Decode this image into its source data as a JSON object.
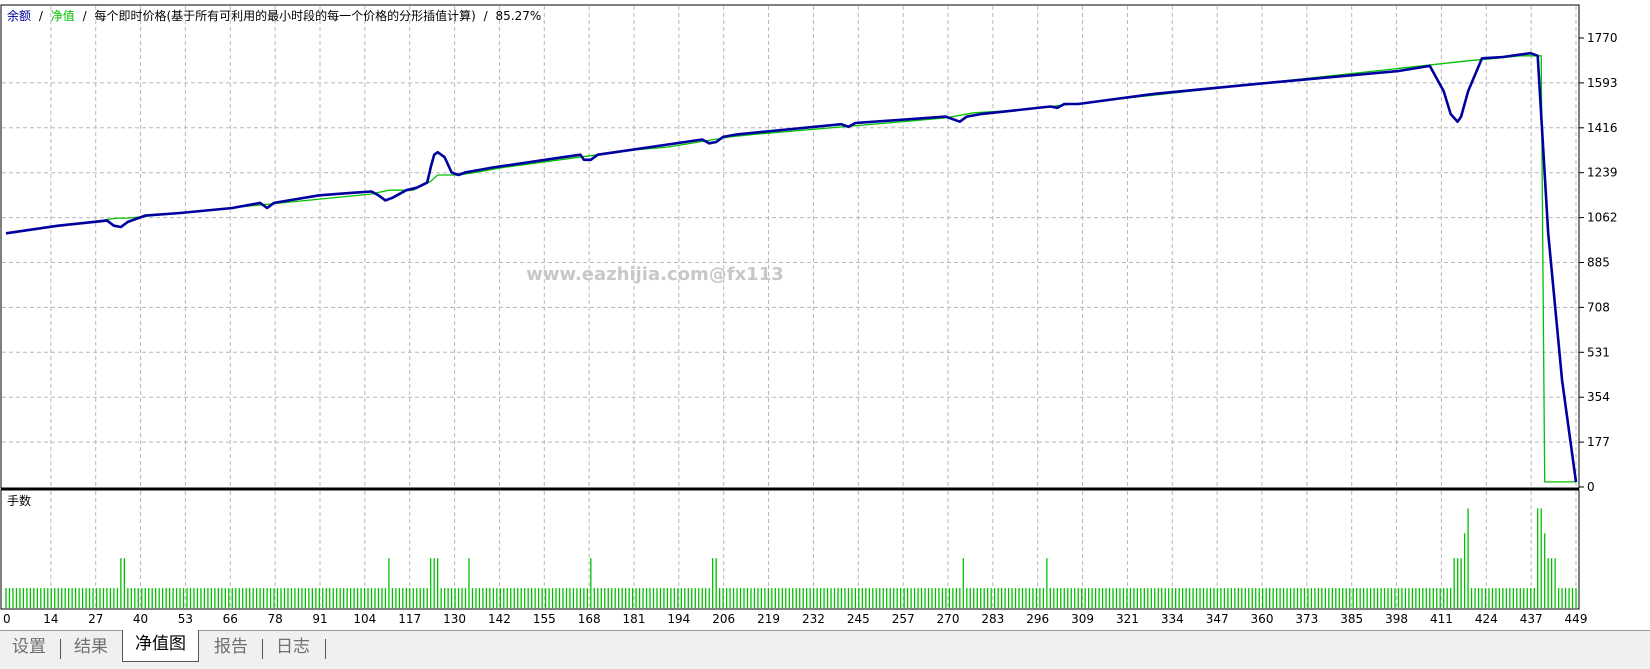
{
  "header": {
    "balance": "余额",
    "sep1": "/",
    "equity": "净值",
    "sep2": "/",
    "method": "每个即时价格(基于所有可利用的最小时段的每一个价格的分形插值计算)",
    "sep3": "/",
    "quality": "85.27%"
  },
  "watermark": "www.eazhijia.com@fx113",
  "lower_panel_label": "手数",
  "tabs": [
    {
      "label": "设置",
      "active": false
    },
    {
      "label": "结果",
      "active": false
    },
    {
      "label": "净值图",
      "active": true
    },
    {
      "label": "报告",
      "active": false
    },
    {
      "label": "日志",
      "active": false
    }
  ],
  "colors": {
    "balance": "#00c000",
    "equity": "#0000a0",
    "lots": "#00c000",
    "grid": "#b8b8b8"
  },
  "chart_data": {
    "type": "line",
    "series": [
      {
        "name": "余额",
        "color": "#00c000",
        "x": [
          0,
          32,
          35,
          105,
          110,
          117,
          122,
          124,
          128,
          130,
          135,
          143,
          170,
          177,
          190,
          208,
          215,
          270,
          278,
          290,
          420,
          428,
          435,
          436,
          441,
          442,
          451
        ],
        "y": [
          1000,
          1060,
          1060,
          1155,
          1170,
          1170,
          1205,
          1230,
          1230,
          1230,
          1240,
          1260,
          1310,
          1325,
          1340,
          1380,
          1390,
          1455,
          1475,
          1485,
          1680,
          1690,
          1700,
          1700,
          1700,
          20,
          20
        ]
      },
      {
        "name": "净值",
        "color": "#0000a0",
        "x": [
          0,
          15,
          29,
          31,
          33,
          35,
          40,
          50,
          65,
          73,
          75,
          77,
          90,
          100,
          105,
          107,
          109,
          111,
          115,
          118,
          121,
          122,
          123,
          124,
          126,
          128,
          130,
          132,
          140,
          160,
          165,
          166,
          168,
          170,
          175,
          200,
          202,
          204,
          206,
          210,
          240,
          242,
          244,
          270,
          272,
          274,
          276,
          280,
          300,
          302,
          304,
          308,
          330,
          360,
          400,
          409,
          413,
          415,
          417,
          418,
          420,
          424,
          430,
          435,
          438,
          440,
          443,
          447,
          451
        ],
        "y": [
          1000,
          1030,
          1050,
          1030,
          1025,
          1045,
          1070,
          1080,
          1100,
          1120,
          1100,
          1120,
          1150,
          1160,
          1165,
          1150,
          1130,
          1140,
          1170,
          1180,
          1200,
          1260,
          1310,
          1320,
          1300,
          1240,
          1230,
          1240,
          1260,
          1300,
          1310,
          1290,
          1290,
          1310,
          1320,
          1370,
          1355,
          1360,
          1380,
          1390,
          1430,
          1420,
          1435,
          1460,
          1450,
          1440,
          1460,
          1470,
          1500,
          1495,
          1510,
          1510,
          1550,
          1590,
          1640,
          1660,
          1560,
          1470,
          1440,
          1460,
          1560,
          1690,
          1695,
          1705,
          1710,
          1700,
          1000,
          420,
          20
        ]
      }
    ],
    "lots": {
      "base": 0.08,
      "spikes": [
        {
          "x": 33,
          "value": 0.2
        },
        {
          "x": 34,
          "value": 0.2
        },
        {
          "x": 110,
          "value": 0.2
        },
        {
          "x": 122,
          "value": 0.2
        },
        {
          "x": 123,
          "value": 0.2
        },
        {
          "x": 124,
          "value": 0.2
        },
        {
          "x": 133,
          "value": 0.2
        },
        {
          "x": 168,
          "value": 0.2
        },
        {
          "x": 203,
          "value": 0.2
        },
        {
          "x": 204,
          "value": 0.2
        },
        {
          "x": 275,
          "value": 0.2
        },
        {
          "x": 299,
          "value": 0.2
        },
        {
          "x": 416,
          "value": 0.2
        },
        {
          "x": 417,
          "value": 0.2
        },
        {
          "x": 418,
          "value": 0.2
        },
        {
          "x": 419,
          "value": 0.3
        },
        {
          "x": 420,
          "value": 0.4
        },
        {
          "x": 440,
          "value": 0.4
        },
        {
          "x": 441,
          "value": 0.4
        },
        {
          "x": 442,
          "value": 0.3
        },
        {
          "x": 443,
          "value": 0.2
        },
        {
          "x": 444,
          "value": 0.2
        },
        {
          "x": 445,
          "value": 0.2
        }
      ]
    },
    "xticks": [
      "0",
      "14",
      "27",
      "40",
      "53",
      "66",
      "78",
      "91",
      "104",
      "117",
      "130",
      "142",
      "155",
      "168",
      "181",
      "194",
      "206",
      "219",
      "232",
      "245",
      "257",
      "270",
      "283",
      "296",
      "309",
      "321",
      "334",
      "347",
      "360",
      "373",
      "385",
      "398",
      "411",
      "424",
      "437",
      "449"
    ],
    "yticks": [
      "0",
      "177",
      "354",
      "531",
      "708",
      "885",
      "1062",
      "1239",
      "1416",
      "1593",
      "1770"
    ],
    "xlim": [
      0,
      451
    ],
    "ylim": [
      0,
      1770
    ],
    "grid": true
  }
}
